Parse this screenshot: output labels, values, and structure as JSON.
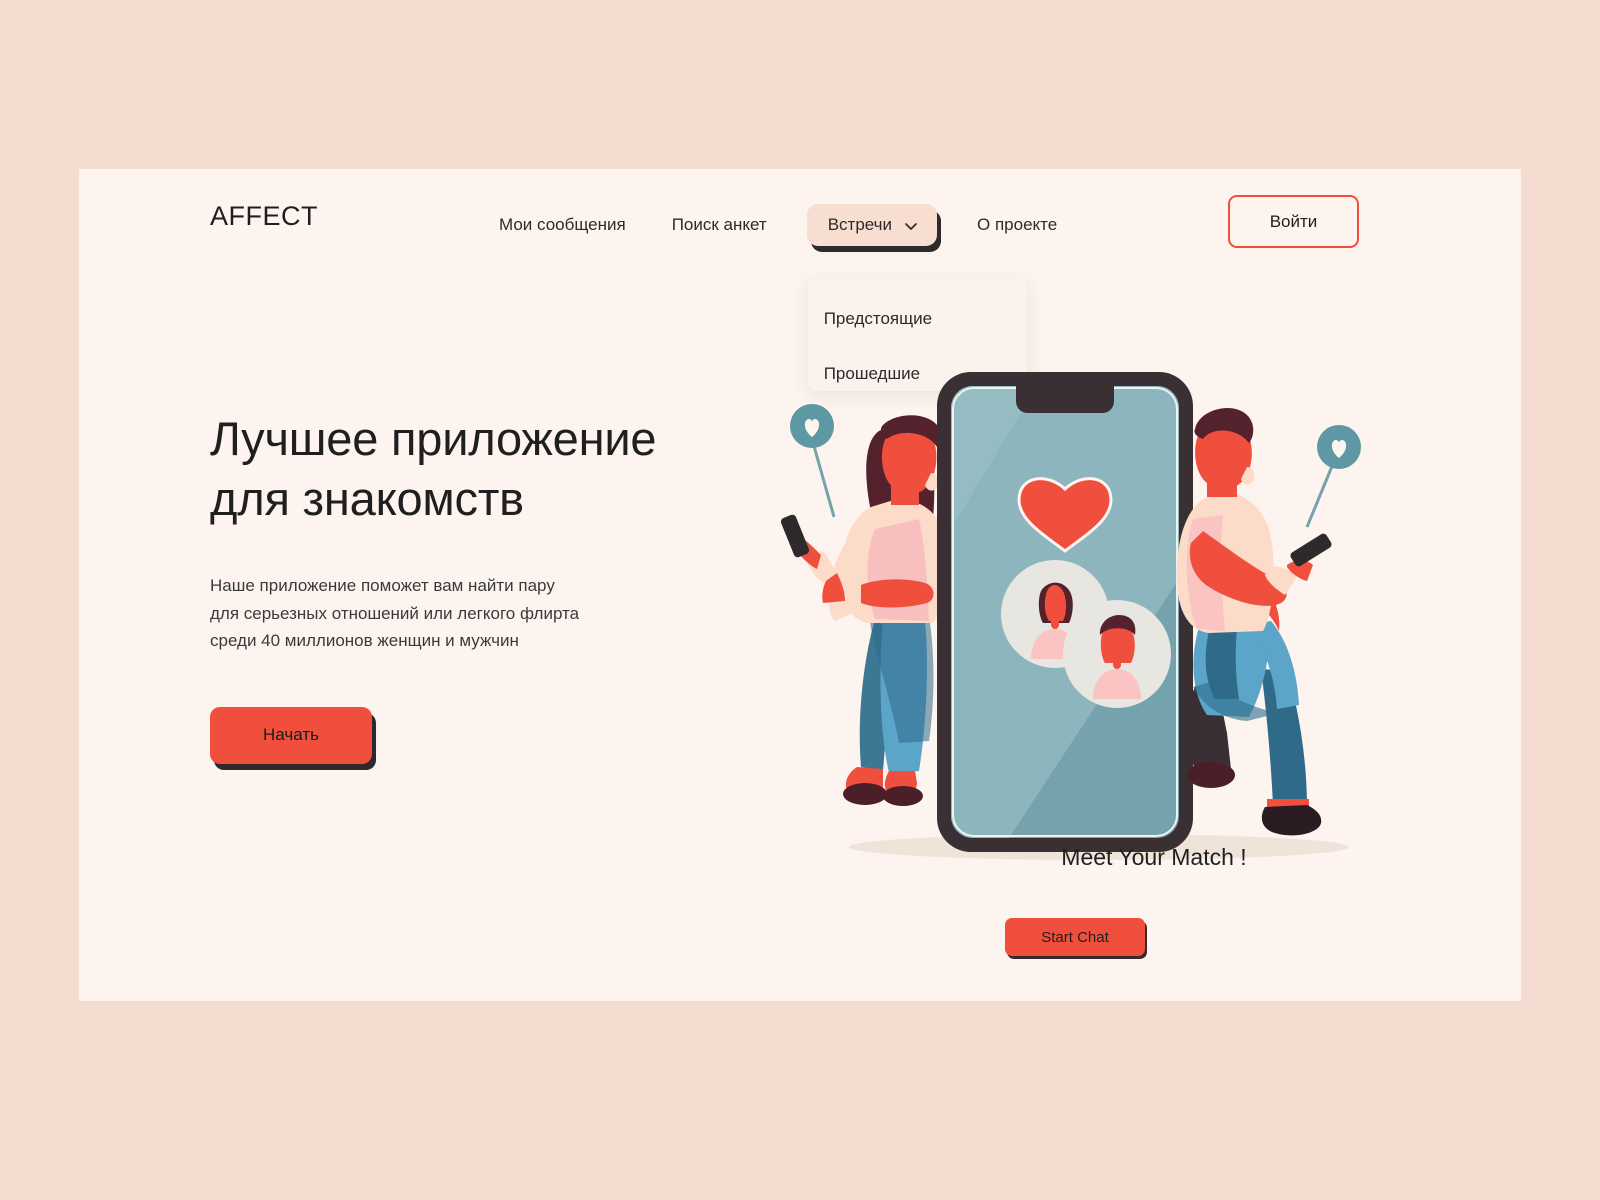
{
  "theme": {
    "page_background": "#f4dcd0",
    "card_background": "#fdf4ef",
    "accent_red": "#ef4f3c",
    "pill_background": "#f8ddd1",
    "shadow_dark": "#2e2a2c",
    "phone_screen_teal": "#74a3ae",
    "text_dark": "#1f1f1f"
  },
  "header": {
    "logo": "AFFECT",
    "nav": [
      {
        "label": "Мои сообщения"
      },
      {
        "label": "Поиск анкет"
      },
      {
        "label": "Встречи",
        "icon": "chevron-down-icon",
        "active": true
      },
      {
        "label": "О проекте"
      }
    ],
    "dropdown": {
      "open": true,
      "items": [
        {
          "label": "Предстоящие"
        },
        {
          "label": "Прошедшие"
        }
      ]
    },
    "login_label": "Войти"
  },
  "hero": {
    "title_line1": "Лучшее приложение",
    "title_line2": "для знакомств",
    "sub_line1": "Наше приложение поможет вам найти пару",
    "sub_line2": "для серьезных отношений или легкого флирта",
    "sub_line3": "среди 40 миллионов женщин и мужчин",
    "cta_label": "Начать"
  },
  "illustration": {
    "phone_heading": "Meet Your Match !",
    "phone_button": "Start Chat",
    "heart_icon": "heart-icon",
    "bubble_left_icon": "heart-bubble-icon",
    "bubble_right_icon": "heart-bubble-icon",
    "avatar_left": "woman-avatar-icon",
    "avatar_right": "man-avatar-icon",
    "character_left": "woman-with-phone-illustration",
    "character_right": "man-with-phone-illustration"
  }
}
